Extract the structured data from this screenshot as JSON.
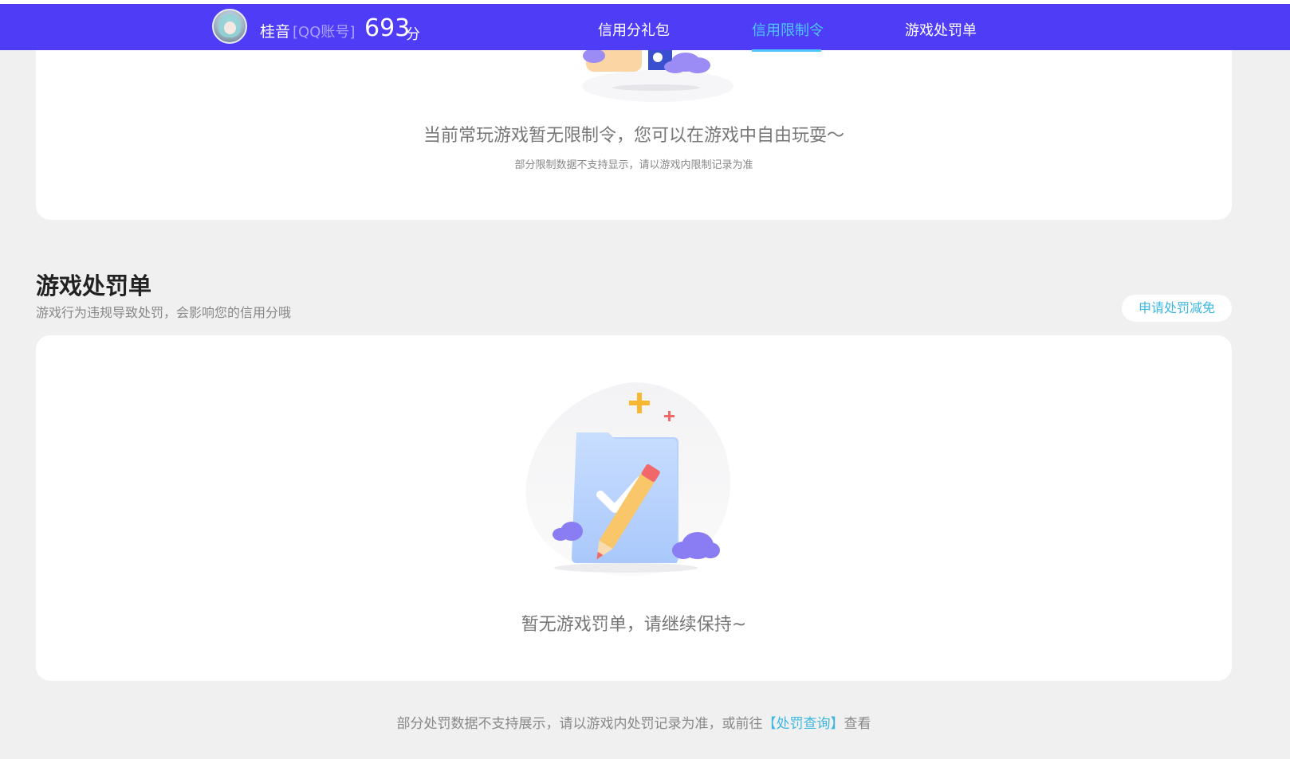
{
  "topbar": {
    "nickname": "桂音",
    "account_type": "[QQ账号]",
    "score": "693",
    "score_unit": "分",
    "tabs": [
      {
        "label": "信用分礼包"
      },
      {
        "label": "信用限制令"
      },
      {
        "label": "游戏处罚单"
      }
    ]
  },
  "restriction": {
    "message": "当前常玩游戏暂无限制令，您可以在游戏中自由玩耍～",
    "note": "部分限制数据不支持显示，请以游戏内限制记录为准"
  },
  "penalty": {
    "title": "游戏处罚单",
    "subtitle": "游戏行为违规导致处罚，会影响您的信用分哦",
    "apply_button": "申请处罚减免",
    "empty_message": "暂无游戏罚单，请继续保持~"
  },
  "footer": {
    "text_before": "部分处罚数据不支持展示，请以游戏内处罚记录为准，或前往",
    "link": "【处罚查询】",
    "text_after": "查看"
  },
  "colors": {
    "nav_bg": "#4f3cf7",
    "active_tab": "#4ec7ff",
    "link": "#3cb7e0",
    "page_bg": "#f0f0f0"
  }
}
